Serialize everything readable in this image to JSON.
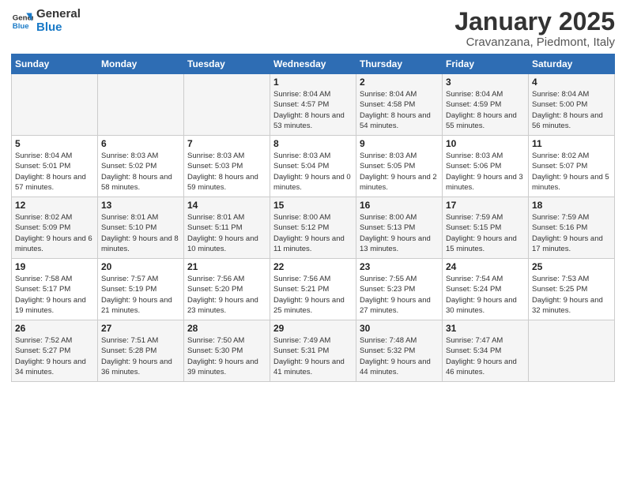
{
  "logo": {
    "line1": "General",
    "line2": "Blue"
  },
  "title": "January 2025",
  "subtitle": "Cravanzana, Piedmont, Italy",
  "days_of_week": [
    "Sunday",
    "Monday",
    "Tuesday",
    "Wednesday",
    "Thursday",
    "Friday",
    "Saturday"
  ],
  "weeks": [
    [
      {
        "day": "",
        "content": ""
      },
      {
        "day": "",
        "content": ""
      },
      {
        "day": "",
        "content": ""
      },
      {
        "day": "1",
        "content": "Sunrise: 8:04 AM\nSunset: 4:57 PM\nDaylight: 8 hours\nand 53 minutes."
      },
      {
        "day": "2",
        "content": "Sunrise: 8:04 AM\nSunset: 4:58 PM\nDaylight: 8 hours\nand 54 minutes."
      },
      {
        "day": "3",
        "content": "Sunrise: 8:04 AM\nSunset: 4:59 PM\nDaylight: 8 hours\nand 55 minutes."
      },
      {
        "day": "4",
        "content": "Sunrise: 8:04 AM\nSunset: 5:00 PM\nDaylight: 8 hours\nand 56 minutes."
      }
    ],
    [
      {
        "day": "5",
        "content": "Sunrise: 8:04 AM\nSunset: 5:01 PM\nDaylight: 8 hours\nand 57 minutes."
      },
      {
        "day": "6",
        "content": "Sunrise: 8:03 AM\nSunset: 5:02 PM\nDaylight: 8 hours\nand 58 minutes."
      },
      {
        "day": "7",
        "content": "Sunrise: 8:03 AM\nSunset: 5:03 PM\nDaylight: 8 hours\nand 59 minutes."
      },
      {
        "day": "8",
        "content": "Sunrise: 8:03 AM\nSunset: 5:04 PM\nDaylight: 9 hours\nand 0 minutes."
      },
      {
        "day": "9",
        "content": "Sunrise: 8:03 AM\nSunset: 5:05 PM\nDaylight: 9 hours\nand 2 minutes."
      },
      {
        "day": "10",
        "content": "Sunrise: 8:03 AM\nSunset: 5:06 PM\nDaylight: 9 hours\nand 3 minutes."
      },
      {
        "day": "11",
        "content": "Sunrise: 8:02 AM\nSunset: 5:07 PM\nDaylight: 9 hours\nand 5 minutes."
      }
    ],
    [
      {
        "day": "12",
        "content": "Sunrise: 8:02 AM\nSunset: 5:09 PM\nDaylight: 9 hours\nand 6 minutes."
      },
      {
        "day": "13",
        "content": "Sunrise: 8:01 AM\nSunset: 5:10 PM\nDaylight: 9 hours\nand 8 minutes."
      },
      {
        "day": "14",
        "content": "Sunrise: 8:01 AM\nSunset: 5:11 PM\nDaylight: 9 hours\nand 10 minutes."
      },
      {
        "day": "15",
        "content": "Sunrise: 8:00 AM\nSunset: 5:12 PM\nDaylight: 9 hours\nand 11 minutes."
      },
      {
        "day": "16",
        "content": "Sunrise: 8:00 AM\nSunset: 5:13 PM\nDaylight: 9 hours\nand 13 minutes."
      },
      {
        "day": "17",
        "content": "Sunrise: 7:59 AM\nSunset: 5:15 PM\nDaylight: 9 hours\nand 15 minutes."
      },
      {
        "day": "18",
        "content": "Sunrise: 7:59 AM\nSunset: 5:16 PM\nDaylight: 9 hours\nand 17 minutes."
      }
    ],
    [
      {
        "day": "19",
        "content": "Sunrise: 7:58 AM\nSunset: 5:17 PM\nDaylight: 9 hours\nand 19 minutes."
      },
      {
        "day": "20",
        "content": "Sunrise: 7:57 AM\nSunset: 5:19 PM\nDaylight: 9 hours\nand 21 minutes."
      },
      {
        "day": "21",
        "content": "Sunrise: 7:56 AM\nSunset: 5:20 PM\nDaylight: 9 hours\nand 23 minutes."
      },
      {
        "day": "22",
        "content": "Sunrise: 7:56 AM\nSunset: 5:21 PM\nDaylight: 9 hours\nand 25 minutes."
      },
      {
        "day": "23",
        "content": "Sunrise: 7:55 AM\nSunset: 5:23 PM\nDaylight: 9 hours\nand 27 minutes."
      },
      {
        "day": "24",
        "content": "Sunrise: 7:54 AM\nSunset: 5:24 PM\nDaylight: 9 hours\nand 30 minutes."
      },
      {
        "day": "25",
        "content": "Sunrise: 7:53 AM\nSunset: 5:25 PM\nDaylight: 9 hours\nand 32 minutes."
      }
    ],
    [
      {
        "day": "26",
        "content": "Sunrise: 7:52 AM\nSunset: 5:27 PM\nDaylight: 9 hours\nand 34 minutes."
      },
      {
        "day": "27",
        "content": "Sunrise: 7:51 AM\nSunset: 5:28 PM\nDaylight: 9 hours\nand 36 minutes."
      },
      {
        "day": "28",
        "content": "Sunrise: 7:50 AM\nSunset: 5:30 PM\nDaylight: 9 hours\nand 39 minutes."
      },
      {
        "day": "29",
        "content": "Sunrise: 7:49 AM\nSunset: 5:31 PM\nDaylight: 9 hours\nand 41 minutes."
      },
      {
        "day": "30",
        "content": "Sunrise: 7:48 AM\nSunset: 5:32 PM\nDaylight: 9 hours\nand 44 minutes."
      },
      {
        "day": "31",
        "content": "Sunrise: 7:47 AM\nSunset: 5:34 PM\nDaylight: 9 hours\nand 46 minutes."
      },
      {
        "day": "",
        "content": ""
      }
    ]
  ]
}
